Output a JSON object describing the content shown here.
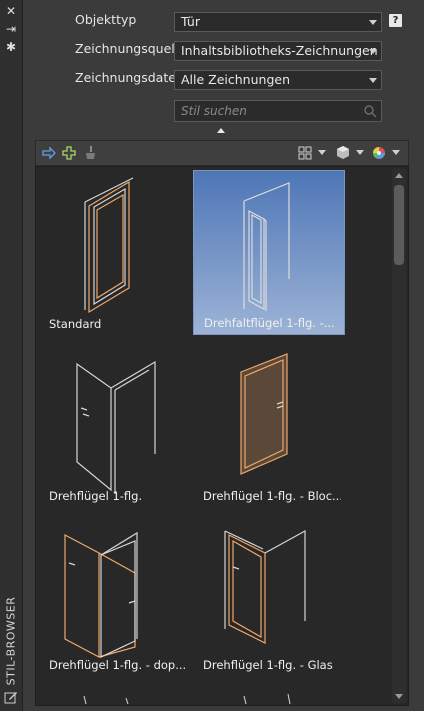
{
  "palette_title": "STIL-BROWSER",
  "filters": {
    "object_type": {
      "label": "Objekttyp",
      "value": "Tür"
    },
    "drawing_source": {
      "label": "Zeichnungsquelle",
      "value": "Inhaltsbibliotheks-Zeichnungen"
    },
    "drawing_file": {
      "label": "Zeichnungsdatei",
      "value": "Alle Zeichnungen"
    }
  },
  "help_label": "?",
  "search": {
    "placeholder": "Stil suchen"
  },
  "titlebar": {
    "close": "✕",
    "autohide": "⇥",
    "settings": "✱"
  },
  "styles": [
    {
      "name": "Standard",
      "selected": false
    },
    {
      "name": "Drehfaltflügel 1-flg. -...",
      "selected": true
    },
    {
      "name": "Drehflügel 1-flg.",
      "selected": false
    },
    {
      "name": "Drehflügel 1-flg. - Bloc...",
      "selected": false
    },
    {
      "name": "Drehflügel 1-flg. - dop...",
      "selected": false
    },
    {
      "name": "Drehflügel 1-flg. - Glas",
      "selected": false
    }
  ],
  "colors": {
    "accent_orange": "#f0a868",
    "wire_grey": "#d6d6d6",
    "selection_blue": "#6f92c8"
  }
}
